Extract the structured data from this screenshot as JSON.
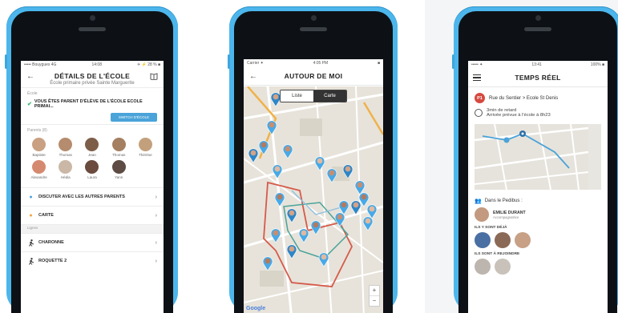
{
  "phone1": {
    "status": {
      "left": "••••• Bouygues 4G",
      "center": "14:08",
      "right": "✈ ⚡ 28 % ■"
    },
    "header": {
      "title": "DÉTAILS DE L'ÉCOLE",
      "subtitle": "École primaire privée Sainte Marguerite"
    },
    "school_section_label": "École",
    "parent_text": "VOUS ÊTES PARENT D'ÉLÈVE DE L'ÉCOLE ECOLE PRIMAI...",
    "change_school_button": "SWITCH D'ÉCOLE",
    "parents_section_label": "Parents (8)",
    "parents": [
      {
        "name": "Baptiste",
        "color": "#c9a081"
      },
      {
        "name": "Thomas",
        "color": "#b58c6e"
      },
      {
        "name": "Jean",
        "color": "#7d5e48"
      },
      {
        "name": "Thomas",
        "color": "#a57f61"
      },
      {
        "name": "Thérèse",
        "color": "#c3a07c"
      },
      {
        "name": "Alexandre",
        "color": "#d58a6f"
      },
      {
        "name": "Hédia",
        "color": "#cbb7a6"
      },
      {
        "name": "Laura",
        "color": "#6a4b3e"
      },
      {
        "name": "Yann",
        "color": "#5d4b44"
      }
    ],
    "menu": [
      {
        "label": "DISCUTER AVEC LES AUTRES PARENTS",
        "icon": "chat-icon",
        "glyph": "💬",
        "color": "#4aa3d9"
      },
      {
        "label": "CARTE",
        "icon": "map-pin-icon",
        "glyph": "●",
        "color": "#f2a33a"
      }
    ],
    "lines_label": "Lignes",
    "lines": [
      {
        "label": "CHARONNE",
        "icon": "walker-icon",
        "glyph": "🚶"
      },
      {
        "label": "ROQUETTE 2",
        "icon": "walker-icon",
        "glyph": "🚶"
      }
    ]
  },
  "phone2": {
    "status": {
      "left": "Carrier ✦",
      "center": "4:05 PM",
      "right": "■"
    },
    "header": {
      "title": "AUTOUR DE MOI"
    },
    "segments": {
      "list": "Liste",
      "map": "Carte"
    },
    "google": "Google",
    "zoom_in": "+",
    "zoom_out": "−"
  },
  "phone3": {
    "status": {
      "left": "••••• ✦",
      "center": "13:41",
      "right": "100% ■"
    },
    "header": {
      "title": "TEMPS RÉEL"
    },
    "route": {
      "badge": "P1",
      "text": "Rue du Sentier > Ecole St Denis"
    },
    "delay": {
      "line1": "3min de retard",
      "line2": "Arrivée prévue à l'école à 8h23"
    },
    "pedibus_label": "Dans le Pedibus :",
    "member": {
      "name": "EMILIE DURANT",
      "sub": "Accompagnatrice"
    },
    "on_board_label": "ILS Y SONT DÉJÀ",
    "to_join_label": "ILS SONT À REJOINDRE",
    "on_board_colors": [
      "#4a6fa3",
      "#8a6a57",
      "#c7a086"
    ],
    "to_join_colors": [
      "#bdb6ae",
      "#c9c2ba"
    ]
  },
  "colors": {
    "accent": "#4aa3d9",
    "phone_body": "#4cb6ec",
    "route_red": "#d65a4a",
    "route_teal": "#4aa39a"
  }
}
